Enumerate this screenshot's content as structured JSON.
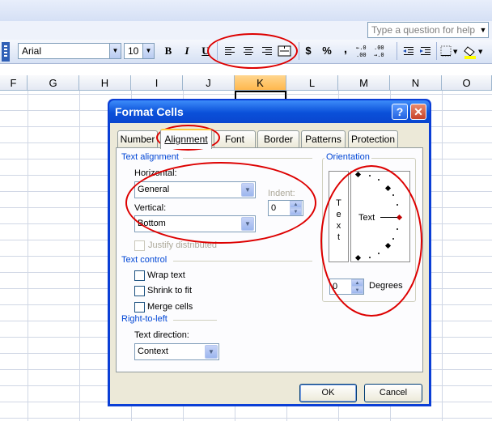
{
  "help_box": {
    "placeholder": "Type a question for help"
  },
  "toolbar": {
    "font_name": "Arial",
    "font_size": "10",
    "bold": "B",
    "italic": "I",
    "underline": "U",
    "currency": "$",
    "percent": "%",
    "comma": ","
  },
  "columns": [
    "F",
    "G",
    "H",
    "I",
    "J",
    "K",
    "L",
    "M",
    "N",
    "O"
  ],
  "selected_column": "K",
  "dialog": {
    "title": "Format Cells",
    "help": "?",
    "tabs": [
      "Number",
      "Alignment",
      "Font",
      "Border",
      "Patterns",
      "Protection"
    ],
    "active_tab": "Alignment",
    "text_alignment": {
      "group": "Text alignment",
      "horizontal_label": "Horizontal:",
      "horizontal_value": "General",
      "vertical_label": "Vertical:",
      "vertical_value": "Bottom",
      "indent_label": "Indent:",
      "indent_value": "0",
      "justify_distributed": "Justify distributed"
    },
    "text_control": {
      "group": "Text control",
      "wrap": "Wrap text",
      "shrink": "Shrink to fit",
      "merge": "Merge cells"
    },
    "rtl": {
      "group": "Right-to-left",
      "direction_label": "Text direction:",
      "direction_value": "Context"
    },
    "orientation": {
      "group": "Orientation",
      "vertical_text": [
        "T",
        "e",
        "x",
        "t"
      ],
      "dial_text": "Text",
      "degrees_value": "0",
      "degrees_label": "Degrees"
    },
    "ok": "OK",
    "cancel": "Cancel"
  }
}
